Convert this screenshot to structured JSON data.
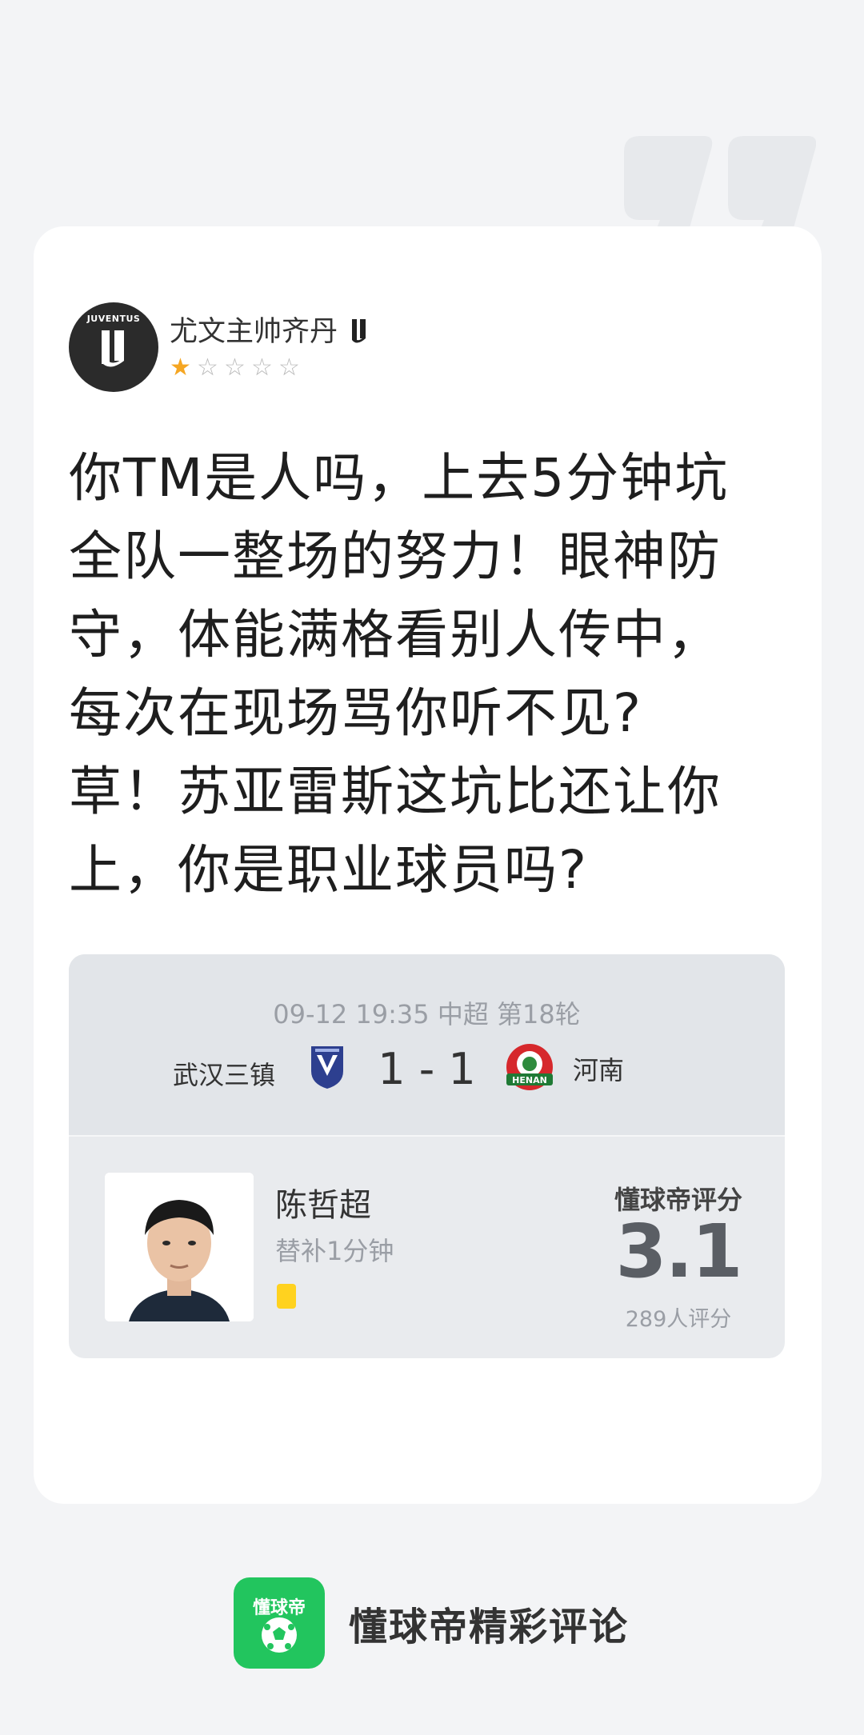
{
  "user": {
    "name": "尤文主帅齐丹",
    "avatar_wordmark": "JUVENTUS",
    "rating_stars": 1,
    "max_stars": 5
  },
  "comment": {
    "lines": [
      "你TM是人吗，上去5分钟坑",
      "全队一整场的努力！眼神防",
      "守，体能满格看别人传中，",
      "每次在现场骂你听不见?",
      "草！苏亚雷斯这坑比还让你",
      "上，你是职业球员吗?"
    ]
  },
  "match": {
    "meta": "09-12 19:35 中超 第18轮",
    "home_team": "武汉三镇",
    "away_team": "河南",
    "away_crest_text": "HENAN",
    "score": "1 - 1"
  },
  "player": {
    "name": "陈哲超",
    "sub_info": "替补1分钟",
    "rating_title": "懂球帝评分",
    "rating": "3.1",
    "rating_count": "289人评分"
  },
  "footer": {
    "logo_text": "懂球帝",
    "tagline": "懂球帝精彩评论"
  },
  "colors": {
    "accent_green": "#22c55e",
    "star_filled": "#f5a623",
    "yellow_card": "#ffd21f"
  }
}
